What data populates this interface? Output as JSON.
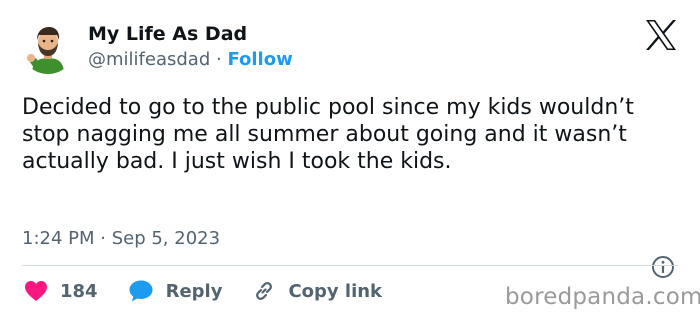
{
  "author": {
    "display_name": "My Life As Dad",
    "handle": "@milifeasdad",
    "separator": "·",
    "follow_label": "Follow"
  },
  "tweet": {
    "text": "Decided to go to the public pool since my kids wouldn’t stop nagging me all summer about going and it wasn’t actually bad. I just wish I took the kids.",
    "timestamp": "1:24 PM · Sep 5, 2023"
  },
  "actions": {
    "likes_count": "184",
    "reply_label": "Reply",
    "copy_link_label": "Copy link"
  },
  "watermark": "boredpanda.com",
  "colors": {
    "like": "#f91880",
    "reply": "#1d9bf0",
    "follow": "#1d9bf0",
    "secondary_text": "#536471"
  },
  "icons": {
    "brand": "x-logo-icon",
    "like": "heart-icon",
    "reply": "speech-bubble-icon",
    "copy_link": "link-icon",
    "info": "info-icon"
  }
}
